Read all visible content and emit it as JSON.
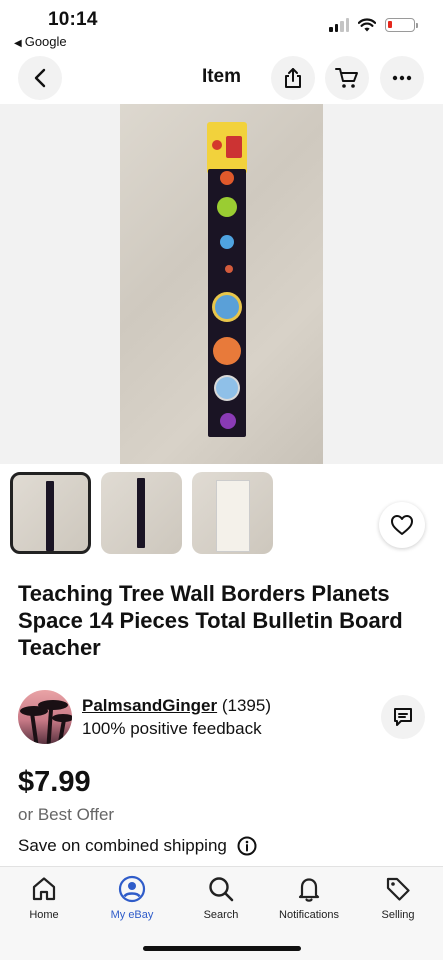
{
  "status_bar": {
    "time": "10:14",
    "back_app": "Google",
    "battery_color": "#e5271c"
  },
  "header": {
    "title": "Item",
    "back_icon": "chevron-left-icon",
    "share_icon": "share-icon",
    "cart_icon": "cart-icon",
    "more_icon": "more-icon"
  },
  "gallery": {
    "image_count": 3,
    "selected_index": 0
  },
  "listing": {
    "title": "Teaching Tree Wall Borders Planets Space 14 Pieces Total Bulletin Board Teacher",
    "price": "$7.99",
    "offer": "or Best Offer",
    "shipping": "Save on combined shipping"
  },
  "seller": {
    "name": "PalmsandGinger",
    "count": "(1395)",
    "feedback": "100% positive feedback"
  },
  "tabs": [
    {
      "label": "Home",
      "icon": "home-icon"
    },
    {
      "label": "My eBay",
      "icon": "user-icon",
      "active": true
    },
    {
      "label": "Search",
      "icon": "search-icon"
    },
    {
      "label": "Notifications",
      "icon": "bell-icon"
    },
    {
      "label": "Selling",
      "icon": "tag-icon"
    }
  ],
  "colors": {
    "accent": "#2f5cc9",
    "text": "#111111",
    "muted": "#666666"
  }
}
